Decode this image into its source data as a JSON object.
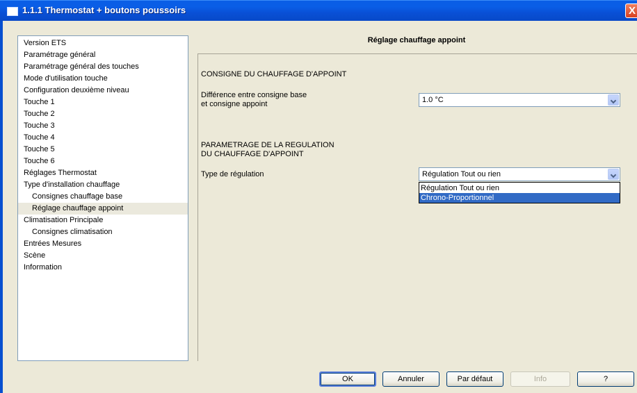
{
  "window": {
    "title": "1.1.1 Thermostat + boutons poussoirs",
    "close_glyph": "X"
  },
  "tree": {
    "items": [
      {
        "label": "Version ETS"
      },
      {
        "label": "Paramétrage général"
      },
      {
        "label": "Paramétrage général des touches"
      },
      {
        "label": "Mode d'utilisation touche"
      },
      {
        "label": "Configuration deuxième niveau"
      },
      {
        "label": "Touche 1"
      },
      {
        "label": "Touche 2"
      },
      {
        "label": "Touche 3"
      },
      {
        "label": "Touche 4"
      },
      {
        "label": "Touche 5"
      },
      {
        "label": "Touche 6"
      },
      {
        "label": "Réglages Thermostat"
      },
      {
        "label": "Type d'installation chauffage"
      },
      {
        "label": "Consignes chauffage base"
      },
      {
        "label": "Réglage chauffage appoint"
      },
      {
        "label": "Climatisation Principale"
      },
      {
        "label": "Consignes climatisation"
      },
      {
        "label": "Entrées Mesures"
      },
      {
        "label": "Scène"
      },
      {
        "label": "Information"
      }
    ]
  },
  "panel": {
    "title": "Réglage chauffage appoint",
    "section1_heading": "CONSIGNE DU CHAUFFAGE D'APPOINT",
    "diff_label_line1": "Différence entre consigne base",
    "diff_label_line2": "et consigne appoint",
    "diff_value": "1.0 °C",
    "section2_heading_line1": "PARAMETRAGE DE LA REGULATION",
    "section2_heading_line2": "DU CHAUFFAGE D'APPOINT",
    "regulation_label": "Type de régulation",
    "regulation_value": "Régulation Tout ou rien",
    "regulation_options": [
      "Régulation Tout ou rien",
      "Chrono-Proportionnel"
    ],
    "highlighted_option": "Chrono-Proportionnel"
  },
  "buttons": {
    "ok": "OK",
    "cancel": "Annuler",
    "default": "Par défaut",
    "info": "Info",
    "help": "?"
  },
  "colors": {
    "titlebar": "#0a5ee6",
    "selection_highlight": "#316ac5",
    "dialog_background": "#ece9d8"
  }
}
